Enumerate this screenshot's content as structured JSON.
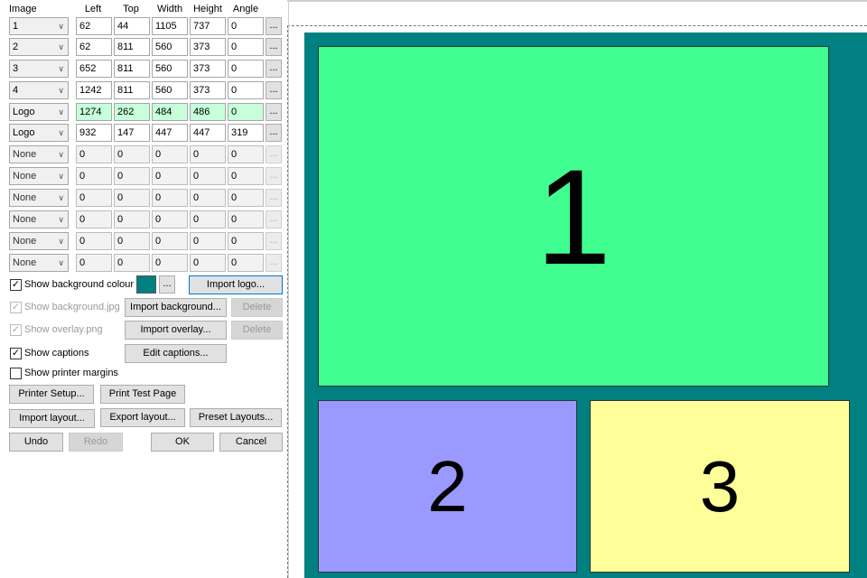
{
  "headers": {
    "image": "Image",
    "left": "Left",
    "top": "Top",
    "width": "Width",
    "height": "Height",
    "angle": "Angle"
  },
  "rows": [
    {
      "image": "1",
      "left": "62",
      "top": "44",
      "width": "1105",
      "height": "737",
      "angle": "0"
    },
    {
      "image": "2",
      "left": "62",
      "top": "811",
      "width": "560",
      "height": "373",
      "angle": "0"
    },
    {
      "image": "3",
      "left": "652",
      "top": "811",
      "width": "560",
      "height": "373",
      "angle": "0"
    },
    {
      "image": "4",
      "left": "1242",
      "top": "811",
      "width": "560",
      "height": "373",
      "angle": "0"
    },
    {
      "image": "Logo",
      "left": "1274",
      "top": "262",
      "width": "484",
      "height": "486",
      "angle": "0"
    },
    {
      "image": "Logo",
      "left": "932",
      "top": "147",
      "width": "447",
      "height": "447",
      "angle": "319"
    },
    {
      "image": "None",
      "left": "0",
      "top": "0",
      "width": "0",
      "height": "0",
      "angle": "0"
    },
    {
      "image": "None",
      "left": "0",
      "top": "0",
      "width": "0",
      "height": "0",
      "angle": "0"
    },
    {
      "image": "None",
      "left": "0",
      "top": "0",
      "width": "0",
      "height": "0",
      "angle": "0"
    },
    {
      "image": "None",
      "left": "0",
      "top": "0",
      "width": "0",
      "height": "0",
      "angle": "0"
    },
    {
      "image": "None",
      "left": "0",
      "top": "0",
      "width": "0",
      "height": "0",
      "angle": "0"
    },
    {
      "image": "None",
      "left": "0",
      "top": "0",
      "width": "0",
      "height": "0",
      "angle": "0"
    }
  ],
  "dots_label": "...",
  "options": {
    "show_bg_colour": "Show background colour",
    "show_bg_jpg": "Show background.jpg",
    "show_overlay": "Show overlay.png",
    "show_captions": "Show captions",
    "show_margins": "Show printer margins"
  },
  "check_mark": "✓",
  "bg_colour": "#008080",
  "buttons": {
    "import_logo": "Import logo...",
    "import_background": "Import background...",
    "delete": "Delete",
    "import_overlay": "Import overlay...",
    "edit_captions": "Edit captions...",
    "printer_setup": "Printer Setup...",
    "print_test": "Print Test Page",
    "import_layout": "Import layout...",
    "export_layout": "Export layout...",
    "preset_layouts": "Preset Layouts...",
    "undo": "Undo",
    "redo": "Redo",
    "ok": "OK",
    "cancel": "Cancel"
  },
  "preview": {
    "tile1": "1",
    "tile1_color": "#40ff90",
    "tile2": "2",
    "tile2_color": "#9999ff",
    "tile3": "3",
    "tile3_color": "#ffff99"
  }
}
